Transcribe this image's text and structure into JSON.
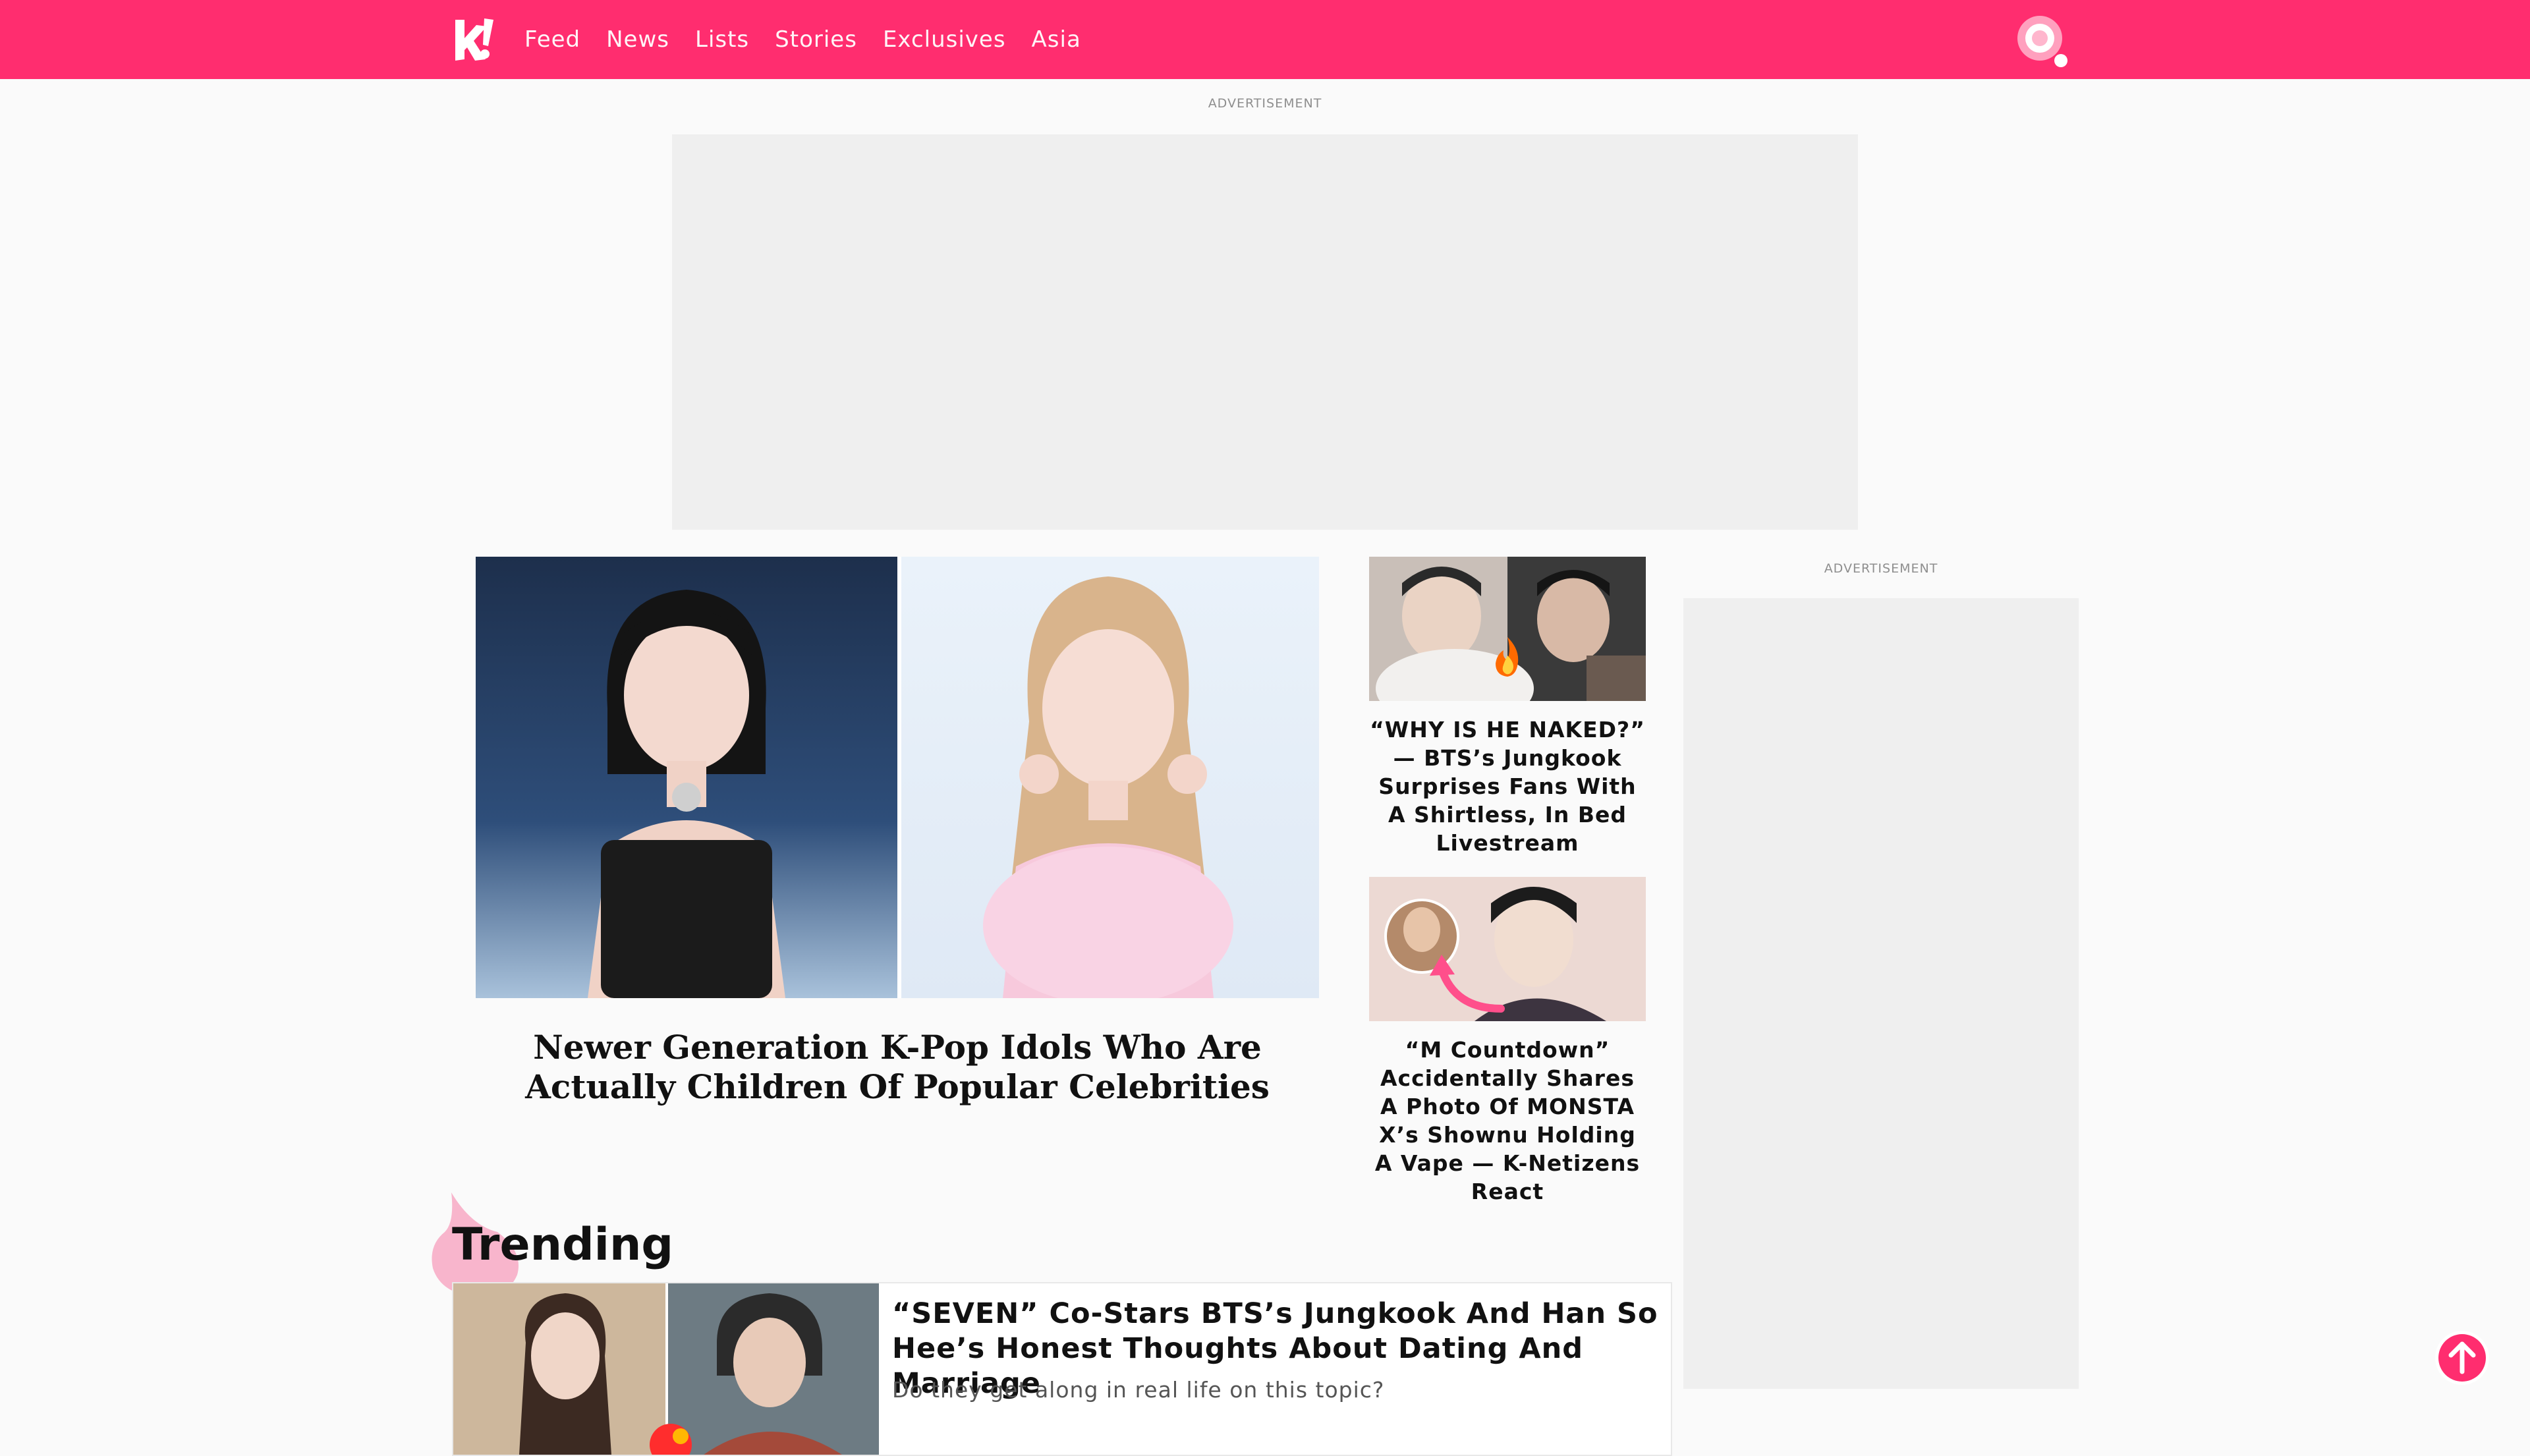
{
  "header": {
    "brand_color": "#ff2d6f",
    "logo": "koreaboo-k-logo",
    "nav": [
      "Feed",
      "News",
      "Lists",
      "Stories",
      "Exclusives",
      "Asia"
    ],
    "search_icon": "search-icon"
  },
  "ads": {
    "top_label": "ADVERTISEMENT",
    "side_label": "ADVERTISEMENT"
  },
  "hero": {
    "title": "Newer Generation K-Pop Idols Who Are Actually Children Of Popular Celebrities"
  },
  "side_articles": [
    {
      "title": "“WHY IS HE NAKED?” — BTS’s Jungkook Surprises Fans With A Shirtless, In Bed Livestream",
      "badge_icon": "fire-emoji-icon"
    },
    {
      "title": "“M Countdown” Accidentally Shares A Photo Of MONSTA X’s Shownu Holding A Vape — K-Netizens React",
      "badge_icon": "pink-arrow-icon"
    }
  ],
  "trending": {
    "heading": "Trending",
    "items": [
      {
        "title": "“SEVEN” Co-Stars BTS’s Jungkook And Han So Hee’s Honest Thoughts About Dating And Marriage",
        "subtitle": "Do they get along in real life on this topic?"
      }
    ]
  },
  "scroll_top_icon": "arrow-up-icon"
}
